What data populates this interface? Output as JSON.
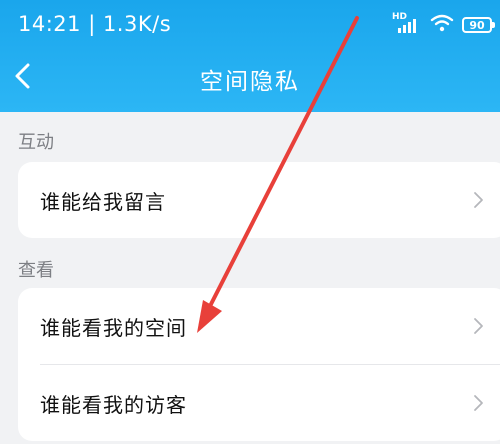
{
  "status_bar": {
    "time_speed": "14:21 | 1.3K/s",
    "hd_label": "HD",
    "battery": "90"
  },
  "header": {
    "title": "空间隐私"
  },
  "sections": [
    {
      "label": "互动",
      "items": [
        {
          "label": "谁能给我留言"
        }
      ]
    },
    {
      "label": "查看",
      "items": [
        {
          "label": "谁能看我的空间"
        },
        {
          "label": "谁能看我的访客"
        }
      ]
    }
  ],
  "icons": {
    "back": "chevron-left-icon",
    "row_chevron": "chevron-right-icon",
    "wifi": "wifi-icon",
    "signal": "signal-icon",
    "battery": "battery-icon"
  },
  "colors": {
    "header": "#1aa6ec",
    "background": "#f1f2f4",
    "annotation_arrow": "#e8403a"
  }
}
